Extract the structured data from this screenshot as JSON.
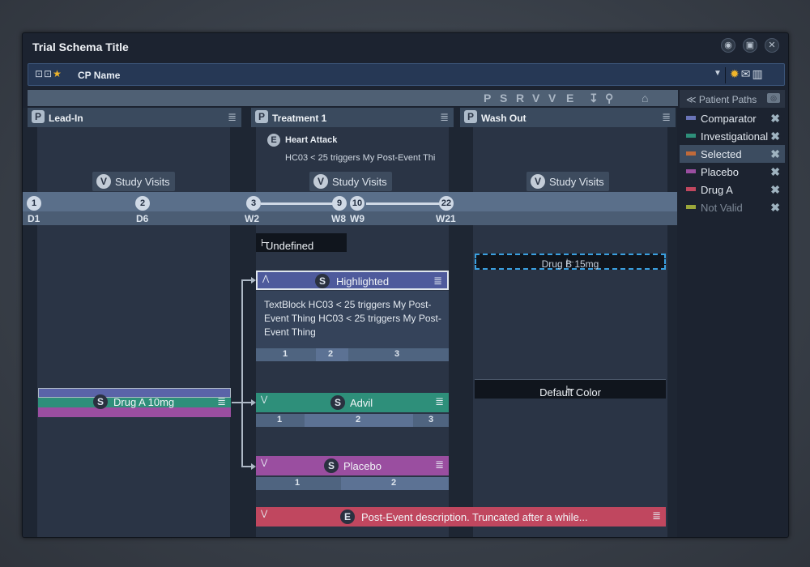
{
  "window": {
    "title": "Trial Schema Title"
  },
  "cp": {
    "name": "CP Name"
  },
  "toolbar": {
    "tools": [
      "P",
      "S",
      "R",
      "V",
      "V",
      "E",
      "↧",
      "⚲",
      "⌂"
    ]
  },
  "patient_paths": {
    "title": "Patient Paths",
    "items": [
      {
        "label": "Comparator",
        "color": "#6a74b8"
      },
      {
        "label": "Investigational",
        "color": "#2e8f7a"
      },
      {
        "label": "Selected",
        "color": "#c06a3a"
      },
      {
        "label": "Placebo",
        "color": "#9a4ea0"
      },
      {
        "label": "Drug A",
        "color": "#c0475f"
      },
      {
        "label": "Not Valid",
        "color": "#9aa63a"
      }
    ]
  },
  "phases": [
    {
      "badge": "P",
      "name": "Lead-In"
    },
    {
      "badge": "P",
      "name": "Treatment 1"
    },
    {
      "badge": "P",
      "name": "Wash Out"
    }
  ],
  "study_visits": {
    "badge": "V",
    "label": "Study Visits"
  },
  "visits": [
    "1",
    "2",
    "3",
    "9",
    "10",
    "22"
  ],
  "days": [
    "D1",
    "D6",
    "W2",
    "W8",
    "W9",
    "W21"
  ],
  "event": {
    "badge": "E",
    "title": "Heart Attack",
    "desc": "HC03 < 25 triggers My Post-Event Thi"
  },
  "undefined_item": {
    "label": "Undefined"
  },
  "drug_b": {
    "label": "Drug B 15mg"
  },
  "default_color": {
    "label": "Default Color"
  },
  "highlighted": {
    "badge": "S",
    "label": "Highlighted",
    "text": "TextBlock HC03 < 25 triggers My Post-Event Thing HC03 < 25 triggers My Post-Event Thing",
    "nums": [
      "1",
      "2",
      "3"
    ]
  },
  "drug_a": {
    "badge": "S",
    "label": "Drug A 10mg"
  },
  "advil": {
    "badge": "S",
    "label": "Advil",
    "nums": [
      "1",
      "2",
      "3"
    ]
  },
  "placebo": {
    "badge": "S",
    "label": "Placebo",
    "nums": [
      "1",
      "2"
    ]
  },
  "post_event": {
    "badge": "E",
    "label": "Post-Event description. Truncated after a while..."
  }
}
